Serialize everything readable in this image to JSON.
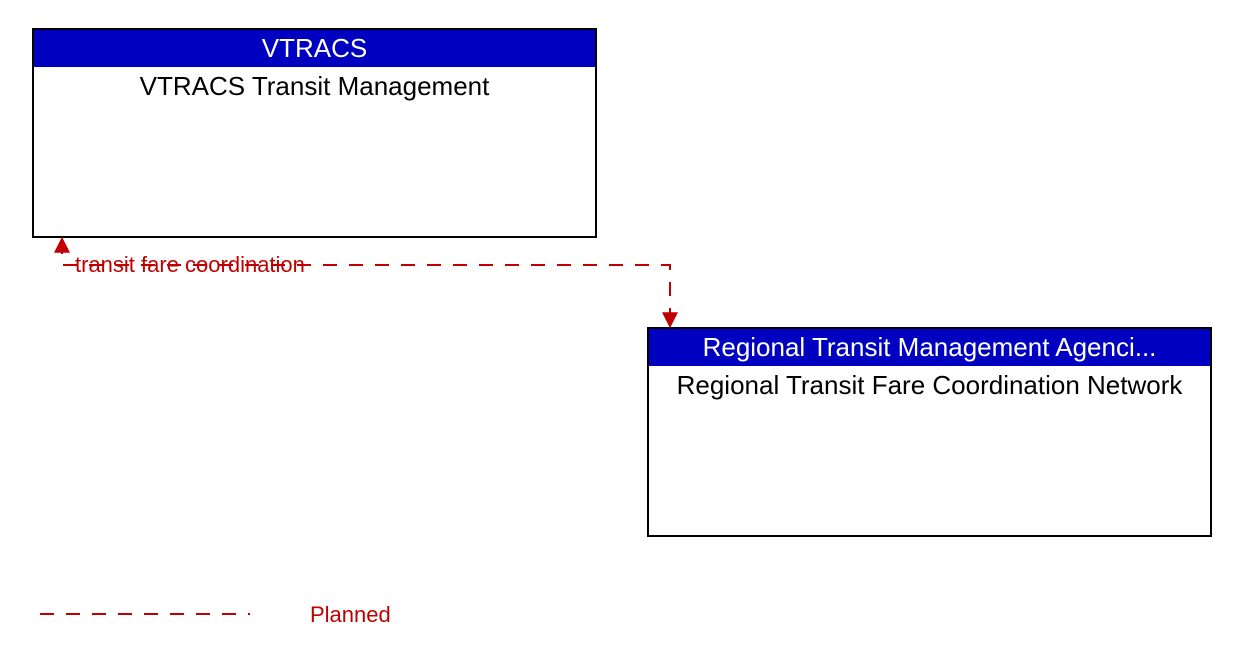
{
  "boxes": {
    "top": {
      "header": "VTRACS",
      "body": "VTRACS Transit Management"
    },
    "bottom": {
      "header": "Regional Transit Management Agenci...",
      "body": "Regional Transit Fare Coordination Network"
    }
  },
  "connector_label": "transit fare coordination",
  "legend": {
    "planned": "Planned"
  },
  "colors": {
    "header_bg": "#0000c0",
    "connector": "#c00000"
  }
}
